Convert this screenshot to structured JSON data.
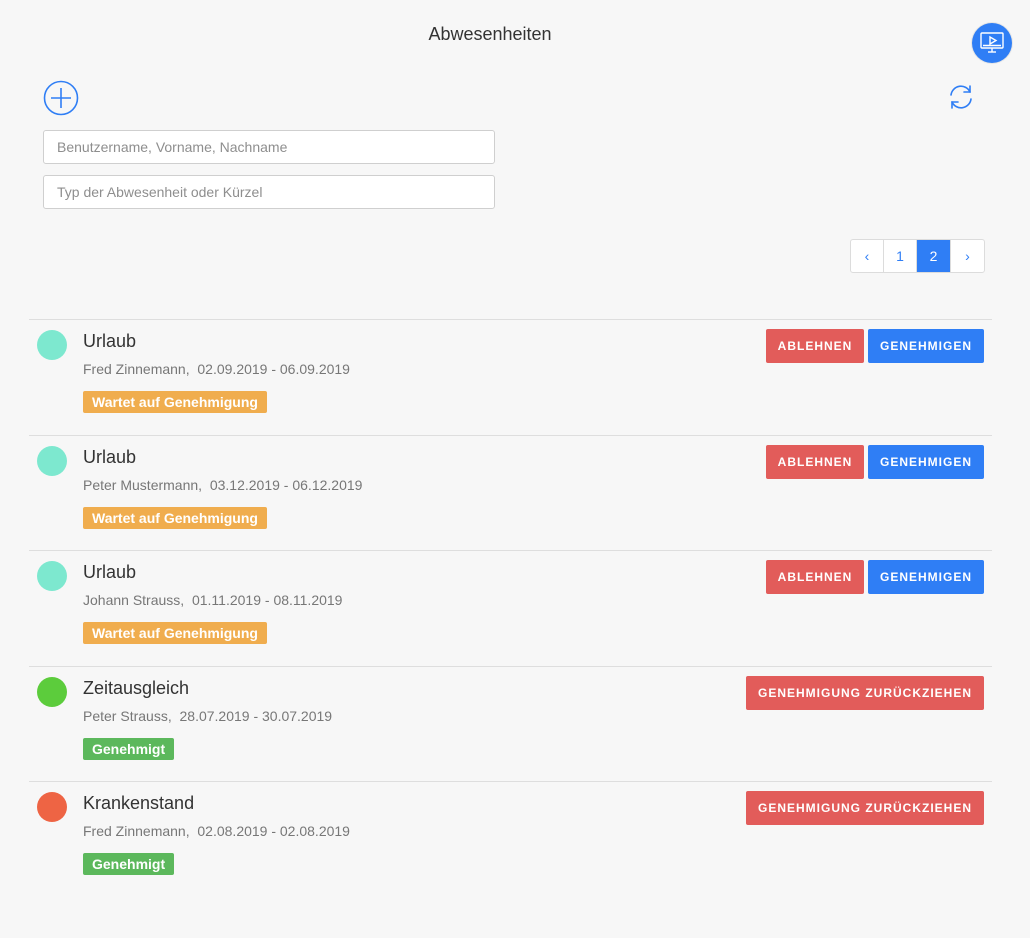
{
  "header": {
    "title": "Abwesenheiten",
    "monitor_icon": "monitor-play-icon",
    "accent_color": "#2f7ef5"
  },
  "toolbar": {
    "add_icon": "plus-circle-icon",
    "refresh_icon": "refresh-icon"
  },
  "filters": {
    "user_placeholder": "Benutzername, Vorname, Nachname",
    "user_value": "",
    "type_placeholder": "Typ der Abwesenheit oder Kürzel",
    "type_value": ""
  },
  "pagination": {
    "prev": "‹",
    "pages": [
      "1",
      "2"
    ],
    "current": "2",
    "next": "›"
  },
  "actions": {
    "reject": "ABLEHNEN",
    "approve": "GENEHMIGEN",
    "withdraw": "GENEHMIGUNG ZURÜCKZIEHEN"
  },
  "absences": [
    {
      "type": "Urlaub",
      "person": "Fred Zinnemann",
      "range": "02.09.2019 - 06.09.2019",
      "status": "Wartet auf Genehmigung",
      "dot_color": "#7de8cf",
      "badge_color": "#f0ad4e"
    },
    {
      "type": "Urlaub",
      "person": "Peter Mustermann",
      "range": "03.12.2019 - 06.12.2019",
      "status": "Wartet auf Genehmigung",
      "dot_color": "#7de8cf",
      "badge_color": "#f0ad4e"
    },
    {
      "type": "Urlaub",
      "person": "Johann Strauss",
      "range": "01.11.2019 - 08.11.2019",
      "status": "Wartet auf Genehmigung",
      "dot_color": "#7de8cf",
      "badge_color": "#f0ad4e"
    },
    {
      "type": "Zeitausgleich",
      "person": "Peter Strauss",
      "range": "28.07.2019 - 30.07.2019",
      "status": "Genehmigt",
      "dot_color": "#5ccc3c",
      "badge_color": "#5cb85c"
    },
    {
      "type": "Krankenstand",
      "person": "Fred Zinnemann",
      "range": "02.08.2019 - 02.08.2019",
      "status": "Genehmigt",
      "dot_color": "#ee6444",
      "badge_color": "#5cb85c"
    }
  ]
}
